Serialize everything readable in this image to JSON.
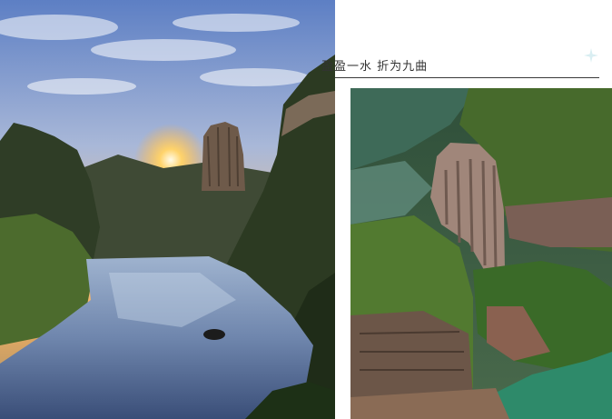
{
  "caption": {
    "text": "盈盈一水 折为九曲"
  },
  "colors": {
    "accent": "#d9eef2",
    "caption_line": "#3a3a3a",
    "background": "#ffffff"
  },
  "icons": {
    "decoration": "sparkle-icon"
  }
}
